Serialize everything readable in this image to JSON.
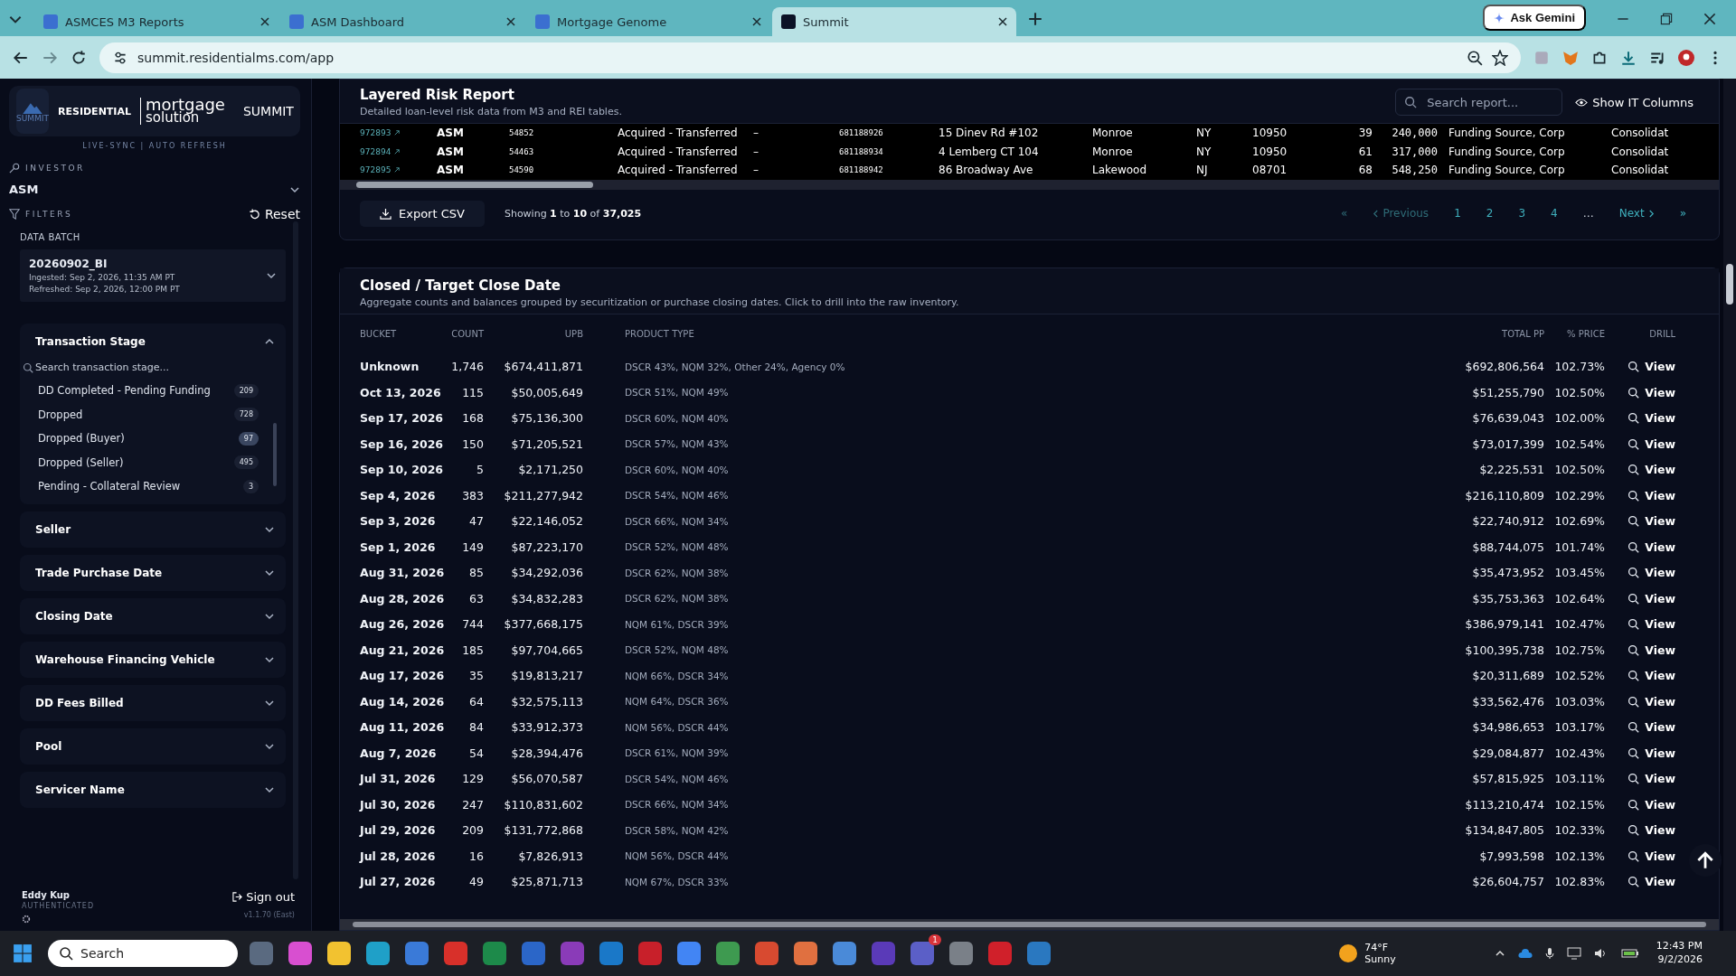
{
  "browser": {
    "tabs": [
      {
        "title": "ASMCES M3 Reports",
        "selected": false
      },
      {
        "title": "ASM Dashboard",
        "selected": false
      },
      {
        "title": "Mortgage Genome",
        "selected": false
      },
      {
        "title": "Summit",
        "selected": true
      }
    ],
    "ask_gemini": "Ask Gemini",
    "url": "summit.residentialms.com/app"
  },
  "sidebar": {
    "logo": {
      "badge": "SUMMIT",
      "brand_top": "RESIDENTIAL",
      "brand_main": "mortgage",
      "brand_sub": "solution",
      "product": "SUMMIT"
    },
    "sync": "LIVE-SYNC  |  AUTO REFRESH",
    "investor_label": "INVESTOR",
    "investor": "ASM",
    "filters_label": "FILTERS",
    "reset": "Reset",
    "data_batch": {
      "label": "DATA BATCH",
      "name": "20260902_BI",
      "ingested": "Ingested: Sep 2, 2026, 11:35 AM PT",
      "refreshed": "Refreshed: Sep 2, 2026, 12:00 PM PT"
    },
    "filters": [
      {
        "title": "Transaction Stage",
        "expanded": true,
        "search_placeholder": "Search transaction stage...",
        "options": [
          {
            "label": "DD Completed - Pending Funding",
            "count": "209",
            "selected": false
          },
          {
            "label": "Dropped",
            "count": "728",
            "selected": false
          },
          {
            "label": "Dropped (Buyer)",
            "count": "97",
            "selected": true
          },
          {
            "label": "Dropped (Seller)",
            "count": "495",
            "selected": false
          },
          {
            "label": "Pending - Collateral Review",
            "count": "3",
            "selected": false
          }
        ]
      },
      {
        "title": "Seller",
        "expanded": false
      },
      {
        "title": "Trade Purchase Date",
        "expanded": false
      },
      {
        "title": "Closing Date",
        "expanded": false
      },
      {
        "title": "Warehouse Financing Vehicle",
        "expanded": false
      },
      {
        "title": "DD Fees Billed",
        "expanded": false
      },
      {
        "title": "Pool",
        "expanded": false
      },
      {
        "title": "Servicer Name",
        "expanded": false
      }
    ],
    "user": {
      "name": "Eddy Kup",
      "status": "AUTHENTICATED"
    },
    "sign_out": "Sign out",
    "version": "v1.1.70 (East)"
  },
  "risk_report": {
    "title": "Layered Risk Report",
    "subtitle": "Detailed loan-level risk data from M3 and REI tables.",
    "search_placeholder": "Search report...",
    "show_columns": "Show IT Columns",
    "rows": [
      [
        "972893",
        "ASM",
        "54852",
        "Acquired - Transferred",
        "–",
        "681188926",
        "15 Dinev Rd #102",
        "Monroe",
        "NY",
        "10950",
        "39",
        "240,000",
        "Funding Source, Corp",
        "Consolidat"
      ],
      [
        "972894",
        "ASM",
        "54463",
        "Acquired - Transferred",
        "–",
        "681188934",
        "4 Lemberg CT 104",
        "Monroe",
        "NY",
        "10950",
        "61",
        "317,000",
        "Funding Source, Corp",
        "Consolidat"
      ],
      [
        "972895",
        "ASM",
        "54590",
        "Acquired - Transferred",
        "–",
        "681188942",
        "86 Broadway Ave",
        "Lakewood",
        "NJ",
        "08701",
        "68",
        "548,250",
        "Funding Source, Corp",
        "Consolidat"
      ]
    ],
    "export": "Export CSV",
    "showing": "Showing **1** to **10** of **37,025**",
    "pagination": [
      {
        "label": "«",
        "kind": "nav",
        "disabled": true
      },
      {
        "label": "Previous",
        "kind": "prev",
        "disabled": true
      },
      {
        "label": "1",
        "kind": "page",
        "disabled": false
      },
      {
        "label": "2",
        "kind": "page",
        "disabled": false
      },
      {
        "label": "3",
        "kind": "page",
        "disabled": false
      },
      {
        "label": "4",
        "kind": "page",
        "disabled": false
      },
      {
        "label": "…",
        "kind": "gap",
        "disabled": false
      },
      {
        "label": "Next",
        "kind": "next",
        "disabled": false
      },
      {
        "label": "»",
        "kind": "nav",
        "disabled": false
      }
    ]
  },
  "closing": {
    "title": "Closed / Target Close Date",
    "subtitle": "Aggregate counts and balances grouped by securitization or purchase closing dates. Click to drill into the raw inventory.",
    "columns": [
      "BUCKET",
      "COUNT",
      "UPB",
      "PRODUCT TYPE",
      "TOTAL PP",
      "% PRICE",
      "DRILL"
    ],
    "rows": [
      {
        "bucket": "Unknown",
        "count": "1,746",
        "upb": "$674,411,871",
        "product": "DSCR 43%, NQM 32%, Other 24%, Agency 0%",
        "total_pp": "$692,806,564",
        "price": "102.73%",
        "drill": "View"
      },
      {
        "bucket": "Oct 13, 2026",
        "count": "115",
        "upb": "$50,005,649",
        "product": "DSCR 51%, NQM 49%",
        "total_pp": "$51,255,790",
        "price": "102.50%",
        "drill": "View"
      },
      {
        "bucket": "Sep 17, 2026",
        "count": "168",
        "upb": "$75,136,300",
        "product": "DSCR 60%, NQM 40%",
        "total_pp": "$76,639,043",
        "price": "102.00%",
        "drill": "View"
      },
      {
        "bucket": "Sep 16, 2026",
        "count": "150",
        "upb": "$71,205,521",
        "product": "DSCR 57%, NQM 43%",
        "total_pp": "$73,017,399",
        "price": "102.54%",
        "drill": "View"
      },
      {
        "bucket": "Sep 10, 2026",
        "count": "5",
        "upb": "$2,171,250",
        "product": "DSCR 60%, NQM 40%",
        "total_pp": "$2,225,531",
        "price": "102.50%",
        "drill": "View"
      },
      {
        "bucket": "Sep 4, 2026",
        "count": "383",
        "upb": "$211,277,942",
        "product": "DSCR 54%, NQM 46%",
        "total_pp": "$216,110,809",
        "price": "102.29%",
        "drill": "View"
      },
      {
        "bucket": "Sep 3, 2026",
        "count": "47",
        "upb": "$22,146,052",
        "product": "DSCR 66%, NQM 34%",
        "total_pp": "$22,740,912",
        "price": "102.69%",
        "drill": "View"
      },
      {
        "bucket": "Sep 1, 2026",
        "count": "149",
        "upb": "$87,223,170",
        "product": "DSCR 52%, NQM 48%",
        "total_pp": "$88,744,075",
        "price": "101.74%",
        "drill": "View"
      },
      {
        "bucket": "Aug 31, 2026",
        "count": "85",
        "upb": "$34,292,036",
        "product": "DSCR 62%, NQM 38%",
        "total_pp": "$35,473,952",
        "price": "103.45%",
        "drill": "View"
      },
      {
        "bucket": "Aug 28, 2026",
        "count": "63",
        "upb": "$34,832,283",
        "product": "DSCR 62%, NQM 38%",
        "total_pp": "$35,753,363",
        "price": "102.64%",
        "drill": "View"
      },
      {
        "bucket": "Aug 26, 2026",
        "count": "744",
        "upb": "$377,668,175",
        "product": "NQM 61%, DSCR 39%",
        "total_pp": "$386,979,141",
        "price": "102.47%",
        "drill": "View"
      },
      {
        "bucket": "Aug 21, 2026",
        "count": "185",
        "upb": "$97,704,665",
        "product": "DSCR 52%, NQM 48%",
        "total_pp": "$100,395,738",
        "price": "102.75%",
        "drill": "View"
      },
      {
        "bucket": "Aug 17, 2026",
        "count": "35",
        "upb": "$19,813,217",
        "product": "NQM 66%, DSCR 34%",
        "total_pp": "$20,311,689",
        "price": "102.52%",
        "drill": "View"
      },
      {
        "bucket": "Aug 14, 2026",
        "count": "64",
        "upb": "$32,575,113",
        "product": "NQM 64%, DSCR 36%",
        "total_pp": "$33,562,476",
        "price": "103.03%",
        "drill": "View"
      },
      {
        "bucket": "Aug 11, 2026",
        "count": "84",
        "upb": "$33,912,373",
        "product": "NQM 56%, DSCR 44%",
        "total_pp": "$34,986,653",
        "price": "103.17%",
        "drill": "View"
      },
      {
        "bucket": "Aug 7, 2026",
        "count": "54",
        "upb": "$28,394,476",
        "product": "DSCR 61%, NQM 39%",
        "total_pp": "$29,084,877",
        "price": "102.43%",
        "drill": "View"
      },
      {
        "bucket": "Jul 31, 2026",
        "count": "129",
        "upb": "$56,070,587",
        "product": "DSCR 54%, NQM 46%",
        "total_pp": "$57,815,925",
        "price": "103.11%",
        "drill": "View"
      },
      {
        "bucket": "Jul 30, 2026",
        "count": "247",
        "upb": "$110,831,602",
        "product": "DSCR 66%, NQM 34%",
        "total_pp": "$113,210,474",
        "price": "102.15%",
        "drill": "View"
      },
      {
        "bucket": "Jul 29, 2026",
        "count": "209",
        "upb": "$131,772,868",
        "product": "DSCR 58%, NQM 42%",
        "total_pp": "$134,847,805",
        "price": "102.33%",
        "drill": "View"
      },
      {
        "bucket": "Jul 28, 2026",
        "count": "16",
        "upb": "$7,826,913",
        "product": "NQM 56%, DSCR 44%",
        "total_pp": "$7,993,598",
        "price": "102.13%",
        "drill": "View"
      },
      {
        "bucket": "Jul 27, 2026",
        "count": "49",
        "upb": "$25,871,713",
        "product": "NQM 67%, DSCR 33%",
        "total_pp": "$26,604,757",
        "price": "102.83%",
        "drill": "View"
      }
    ]
  },
  "taskbar": {
    "search_placeholder": "Search",
    "notification_badge": "1",
    "temperature": "74°F",
    "weather": "Sunny",
    "time": "12:43 PM",
    "date": "9/2/2026"
  }
}
